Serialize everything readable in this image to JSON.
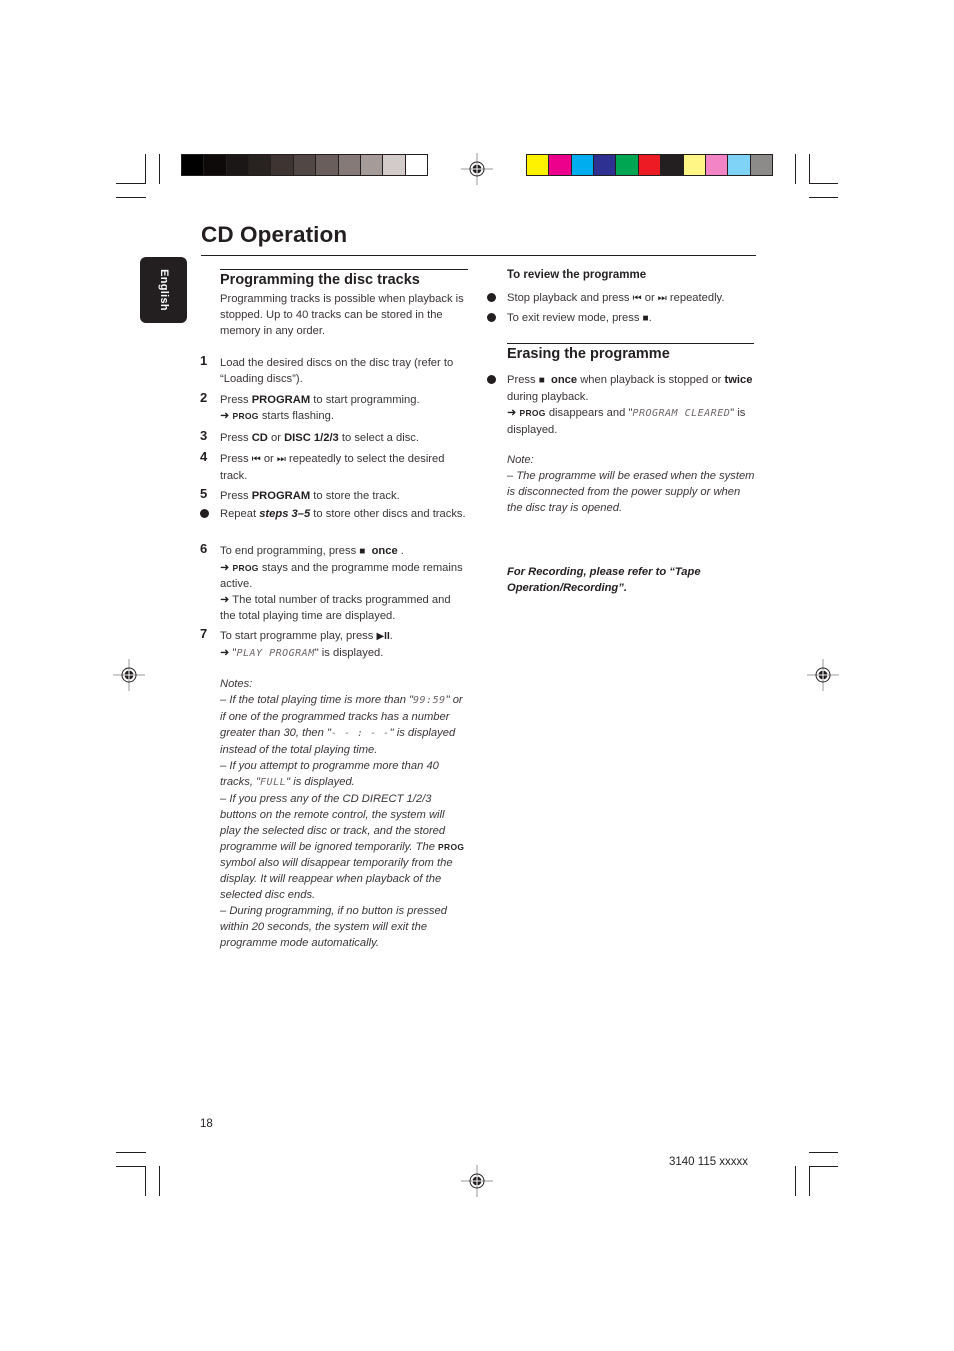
{
  "page": {
    "title": "CD Operation",
    "language_tab": "English",
    "page_number": "18",
    "doc_code": "3140 115 xxxxx"
  },
  "color_bars": {
    "grayscale": [
      "#000000",
      "#0d0a09",
      "#1b1716",
      "#282320",
      "#3e3432",
      "#514745",
      "#6a5e5c",
      "#857a78",
      "#a59c9a",
      "#d3cbca",
      "#ffffff"
    ],
    "process": [
      "#fff200",
      "#ec008c",
      "#00aeef",
      "#2e3192",
      "#00a651",
      "#ed1c24",
      "#231f20",
      "#fff685",
      "#f384c6",
      "#7fd3f7",
      "#8d8b8a"
    ]
  },
  "programming": {
    "heading": "Programming the disc tracks",
    "intro": "Programming tracks is possible when playback is stopped. Up to 40 tracks can be stored in the memory in any order.",
    "steps": [
      {
        "num": "1",
        "text": "Load the desired discs on the disc tray (refer to “Loading discs”)."
      },
      {
        "num": "2",
        "pre": "Press ",
        "bold": "PROGRAM",
        "post": " to start programming.",
        "sub_prog": "PROG",
        "sub_text": " starts flashing."
      },
      {
        "num": "3",
        "pre": "Press ",
        "bold1": "CD",
        "mid": " or ",
        "bold2": "DISC 1/2/3",
        "post": " to select a disc."
      },
      {
        "num": "4",
        "pre": "Press ",
        "sym1": "⏮",
        "mid": " or ",
        "sym2": "⏭",
        "post": " repeatedly to select the desired track."
      },
      {
        "num": "5",
        "pre": "Press ",
        "bold": "PROGRAM",
        "post": " to store the track."
      },
      {
        "bullet": true,
        "pre": "Repeat ",
        "bolditalic": "steps 3–5",
        "post": " to store other discs and tracks."
      },
      {
        "num": "6",
        "pre": "To end programming, press ",
        "sym": "■",
        "bold": "once",
        "post": " .",
        "sub1_prog": "PROG",
        "sub1_text": " stays and the programme mode remains active.",
        "sub2_text": " The total number of tracks programmed and the total playing time are displayed."
      },
      {
        "num": "7",
        "pre": "To start programme play, press ",
        "sym": "▶II",
        "post": ".",
        "sub_lcd": "PLAY PROGRAM",
        "sub_text": " is displayed."
      }
    ],
    "notes_label": "Notes:",
    "notes": [
      {
        "pre": "–  If the total playing time is more than \"",
        "lcd": "99:59",
        "post": "\" or if one of the programmed tracks has a number greater than 30, then \"",
        "lcd2": "- - : - -",
        "post2": "\" is displayed instead of the total playing time."
      },
      {
        "pre": "–  If you attempt to programme more than 40 tracks, \"",
        "lcd": "FULL",
        "post": "\" is displayed."
      },
      {
        "pre": "–  If you press any of the CD DIRECT 1/2/3 buttons on the remote control, the system will play the selected disc or track, and the stored programme will be ignored temporarily. The ",
        "prog": "PROG",
        "post": " symbol also will disappear temporarily from the display. It will reappear when playback of the selected disc ends."
      },
      {
        "pre": "–  During programming, if no button is pressed within 20 seconds, the system will exit the programme mode automatically."
      }
    ]
  },
  "review": {
    "heading": "To review the programme",
    "items": [
      {
        "pre": "Stop playback and press ",
        "sym1": "⏮",
        "mid": " or ",
        "sym2": "⏭",
        "post": " repeatedly."
      },
      {
        "pre": "To exit review mode, press ",
        "sym": "■",
        "post": "."
      }
    ]
  },
  "erasing": {
    "heading": "Erasing the programme",
    "item": {
      "pre": "Press ",
      "sym": "■",
      "bold1": "once",
      "mid": " when playback is stopped or ",
      "bold2": "twice",
      "post": " during playback.",
      "sub_prog": "PROG",
      "sub_pre": " disappears and \"",
      "sub_lcd": "PROGRAM CLEARED",
      "sub_post": "\" is displayed."
    },
    "note_label": "Note:",
    "note": "–  The programme will be erased when the system is disconnected from the power supply or when the disc tray is opened.",
    "recording_ref": "For Recording, please refer to “Tape Operation/Recording”."
  },
  "icons": {
    "arrow": "➜"
  }
}
